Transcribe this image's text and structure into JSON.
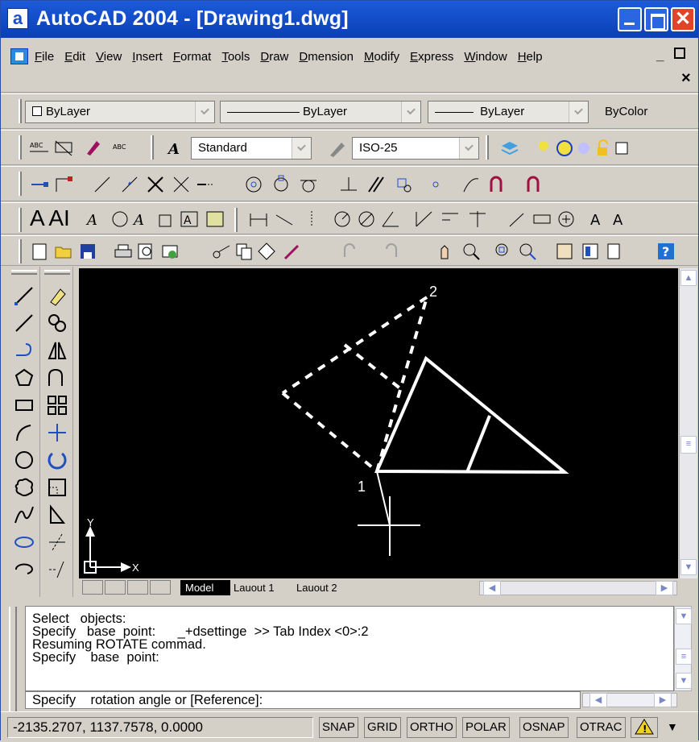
{
  "window": {
    "icon_letter": "a",
    "title": "AutoCAD 2004 - [Drawing1.dwg]"
  },
  "menu": {
    "items": [
      "File",
      "Edit",
      "View",
      "Insert",
      "Format",
      "Tools",
      "Draw",
      "Dmension",
      "Modify",
      "Express",
      "Window",
      "Help"
    ],
    "mdi_close": "×"
  },
  "properties_toolbar": {
    "layer": "ByLayer",
    "linetype": "ByLayer",
    "lineweight": "ByLayer",
    "color": "ByColor"
  },
  "styles_toolbar": {
    "text_style": "Standard",
    "dim_style": "ISO-25"
  },
  "drawing": {
    "point_1_label": "1",
    "point_2_label": "2",
    "ucs_x_label": "X",
    "ucs_y_label": "Y"
  },
  "layout_tabs": {
    "model": "Model",
    "layout1": "Lauout 1",
    "layout2": "Lauout 2"
  },
  "command_history": [
    "Select   objects:",
    "Specify   base  point:      _+dsettinge  >> Tab Index <0>:2",
    "Resuming ROTATE commad.",
    "Specify    base  point:"
  ],
  "command_prompt": "Specify    rotation angle or [Reference]:",
  "status": {
    "coordinates": "-2135.2707, 1137.7578, 0.0000",
    "snap": "SNAP",
    "grid": "GRID",
    "ortho": "ORTHO",
    "polar": "POLAR",
    "osnap": "OSNAP",
    "otrack": "OTRAC"
  },
  "colors": {
    "titlebar": "#0a3fb8",
    "canvas": "#000000",
    "chrome": "#d4d0c8"
  }
}
